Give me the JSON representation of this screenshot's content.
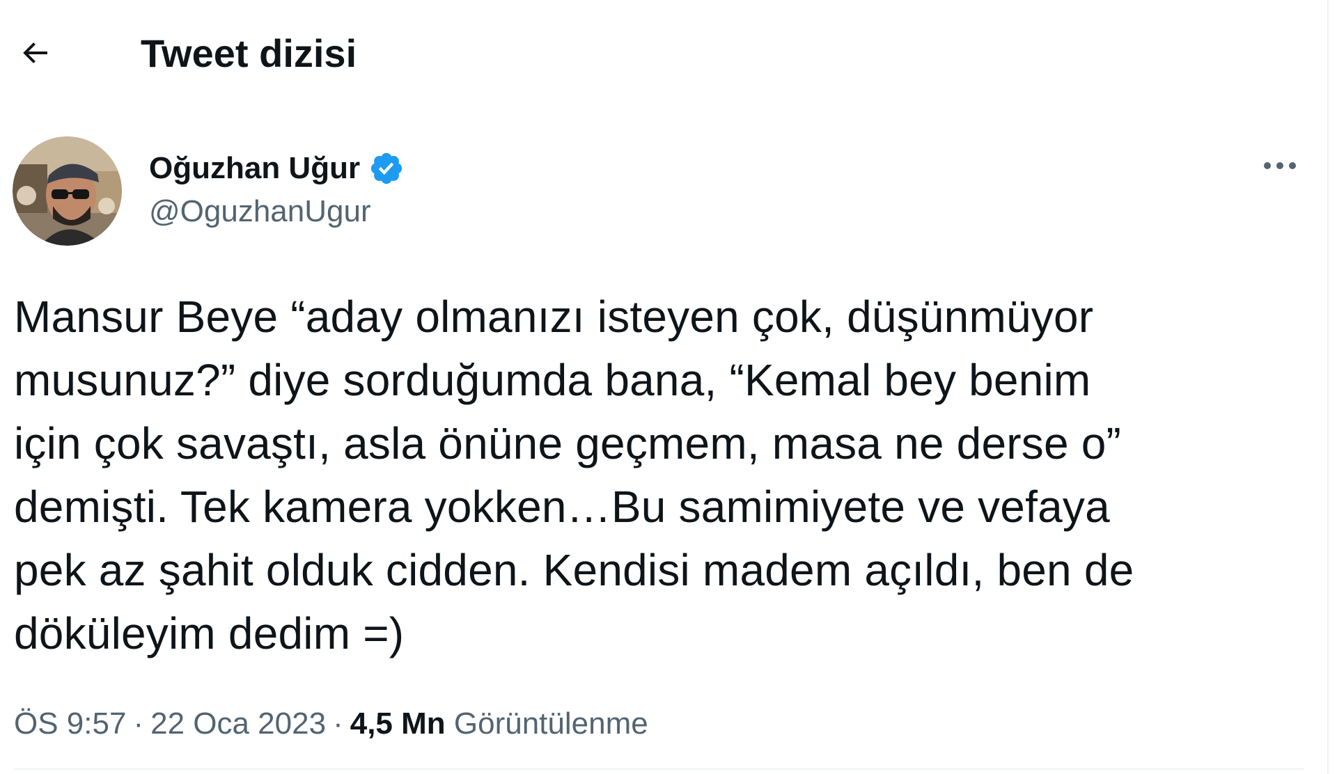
{
  "header": {
    "back_icon": "arrow-left-icon",
    "title": "Tweet dizisi"
  },
  "author": {
    "display_name": "Oğuzhan Uğur",
    "handle": "@OguzhanUgur",
    "verified": true,
    "verified_icon": "verified-badge-icon",
    "verified_color": "#1d9bf0"
  },
  "more_icon": "more-horizontal-icon",
  "tweet": {
    "text": "Mansur Beye “aday olmanızı isteyen çok, düşünmüyor\nmusunuz?” diye sorduğumda bana, “Kemal bey benim\niçin çok savaştı, asla önüne geçmem, masa ne derse o”\ndemişti. Tek kamera yokken…Bu samimiyete ve vefaya\npek az şahit olduk cidden. Kendisi madem açıldı, ben de\ndöküleyim dedim =)"
  },
  "meta": {
    "time": "ÖS 9:57",
    "separator": "·",
    "date": "22 Oca 2023",
    "views_count": "4,5 Mn",
    "views_label": "Görüntülenme"
  },
  "colors": {
    "text_primary": "#0f1419",
    "text_secondary": "#536471",
    "divider": "#eff3f4",
    "accent": "#1d9bf0"
  }
}
